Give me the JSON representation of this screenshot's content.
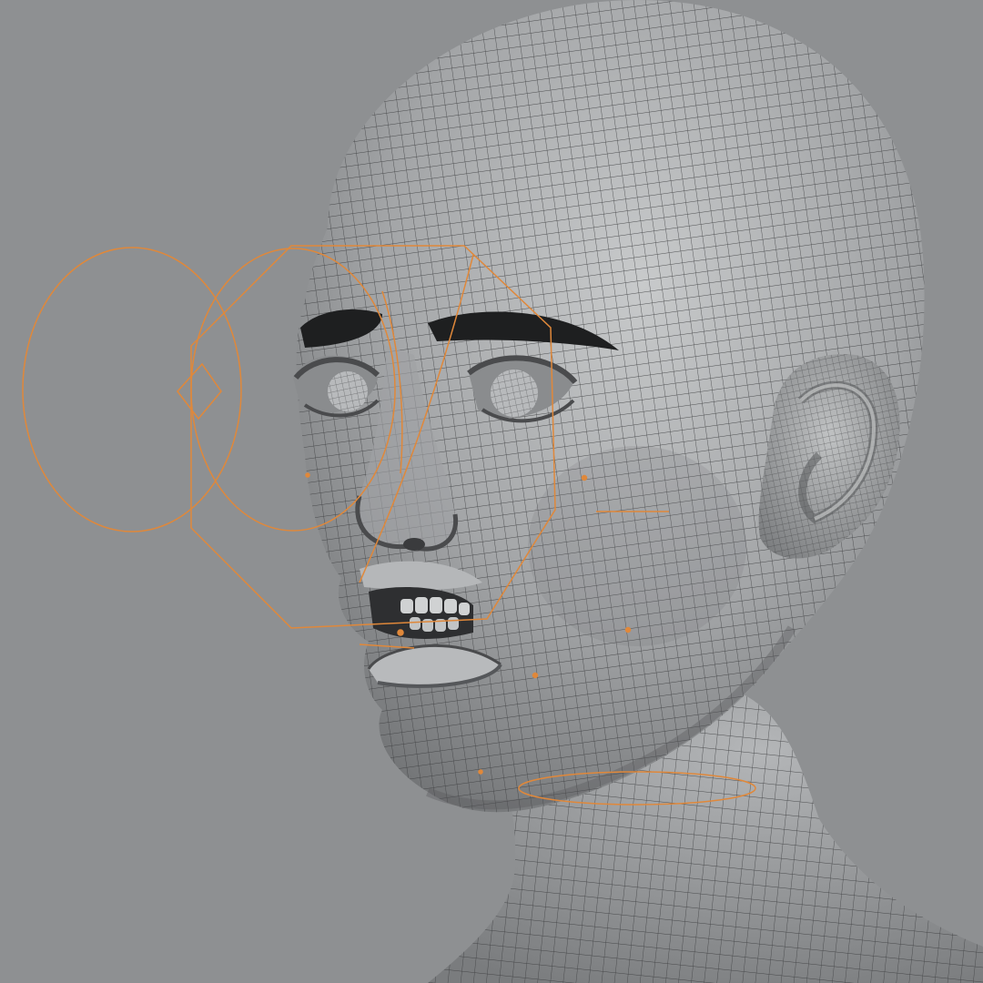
{
  "scene": {
    "subject": "head-wireframe-render",
    "background_color": "#8e9092",
    "skin_color": "#a8aaab",
    "wire_color": "#3c3d3f",
    "rig_color": "#e0883a"
  }
}
